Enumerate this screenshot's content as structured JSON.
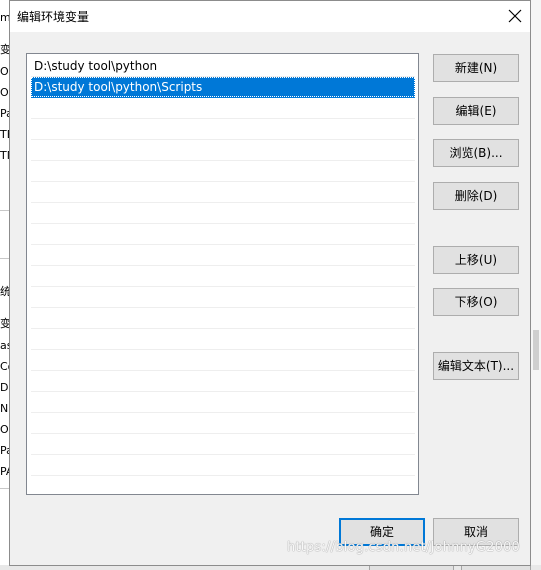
{
  "dialog": {
    "title": "编辑环境变量",
    "close_label": "✕"
  },
  "paths": [
    {
      "value": "D:\\study tool\\python",
      "selected": false
    },
    {
      "value": "D:\\study tool\\python\\Scripts",
      "selected": true
    }
  ],
  "buttons": {
    "new": "新建(N)",
    "edit": "编辑(E)",
    "browse": "浏览(B)...",
    "delete": "删除(D)",
    "move_up": "上移(U)",
    "move_down": "下移(O)",
    "edit_text": "编辑文本(T)...",
    "ok": "确定",
    "cancel": "取消"
  },
  "colors": {
    "selection": "#0078d7",
    "default_button_border": "#0078d7"
  },
  "watermark": "https://blog.csdn.net/JohnnyG2000",
  "background_fragments": [
    "m",
    "变",
    "O",
    "O",
    "Pa",
    "TE",
    "TM",
    "统",
    "变",
    "as",
    "Co",
    "Dr",
    "N",
    "O",
    "Pa",
    "PA"
  ]
}
